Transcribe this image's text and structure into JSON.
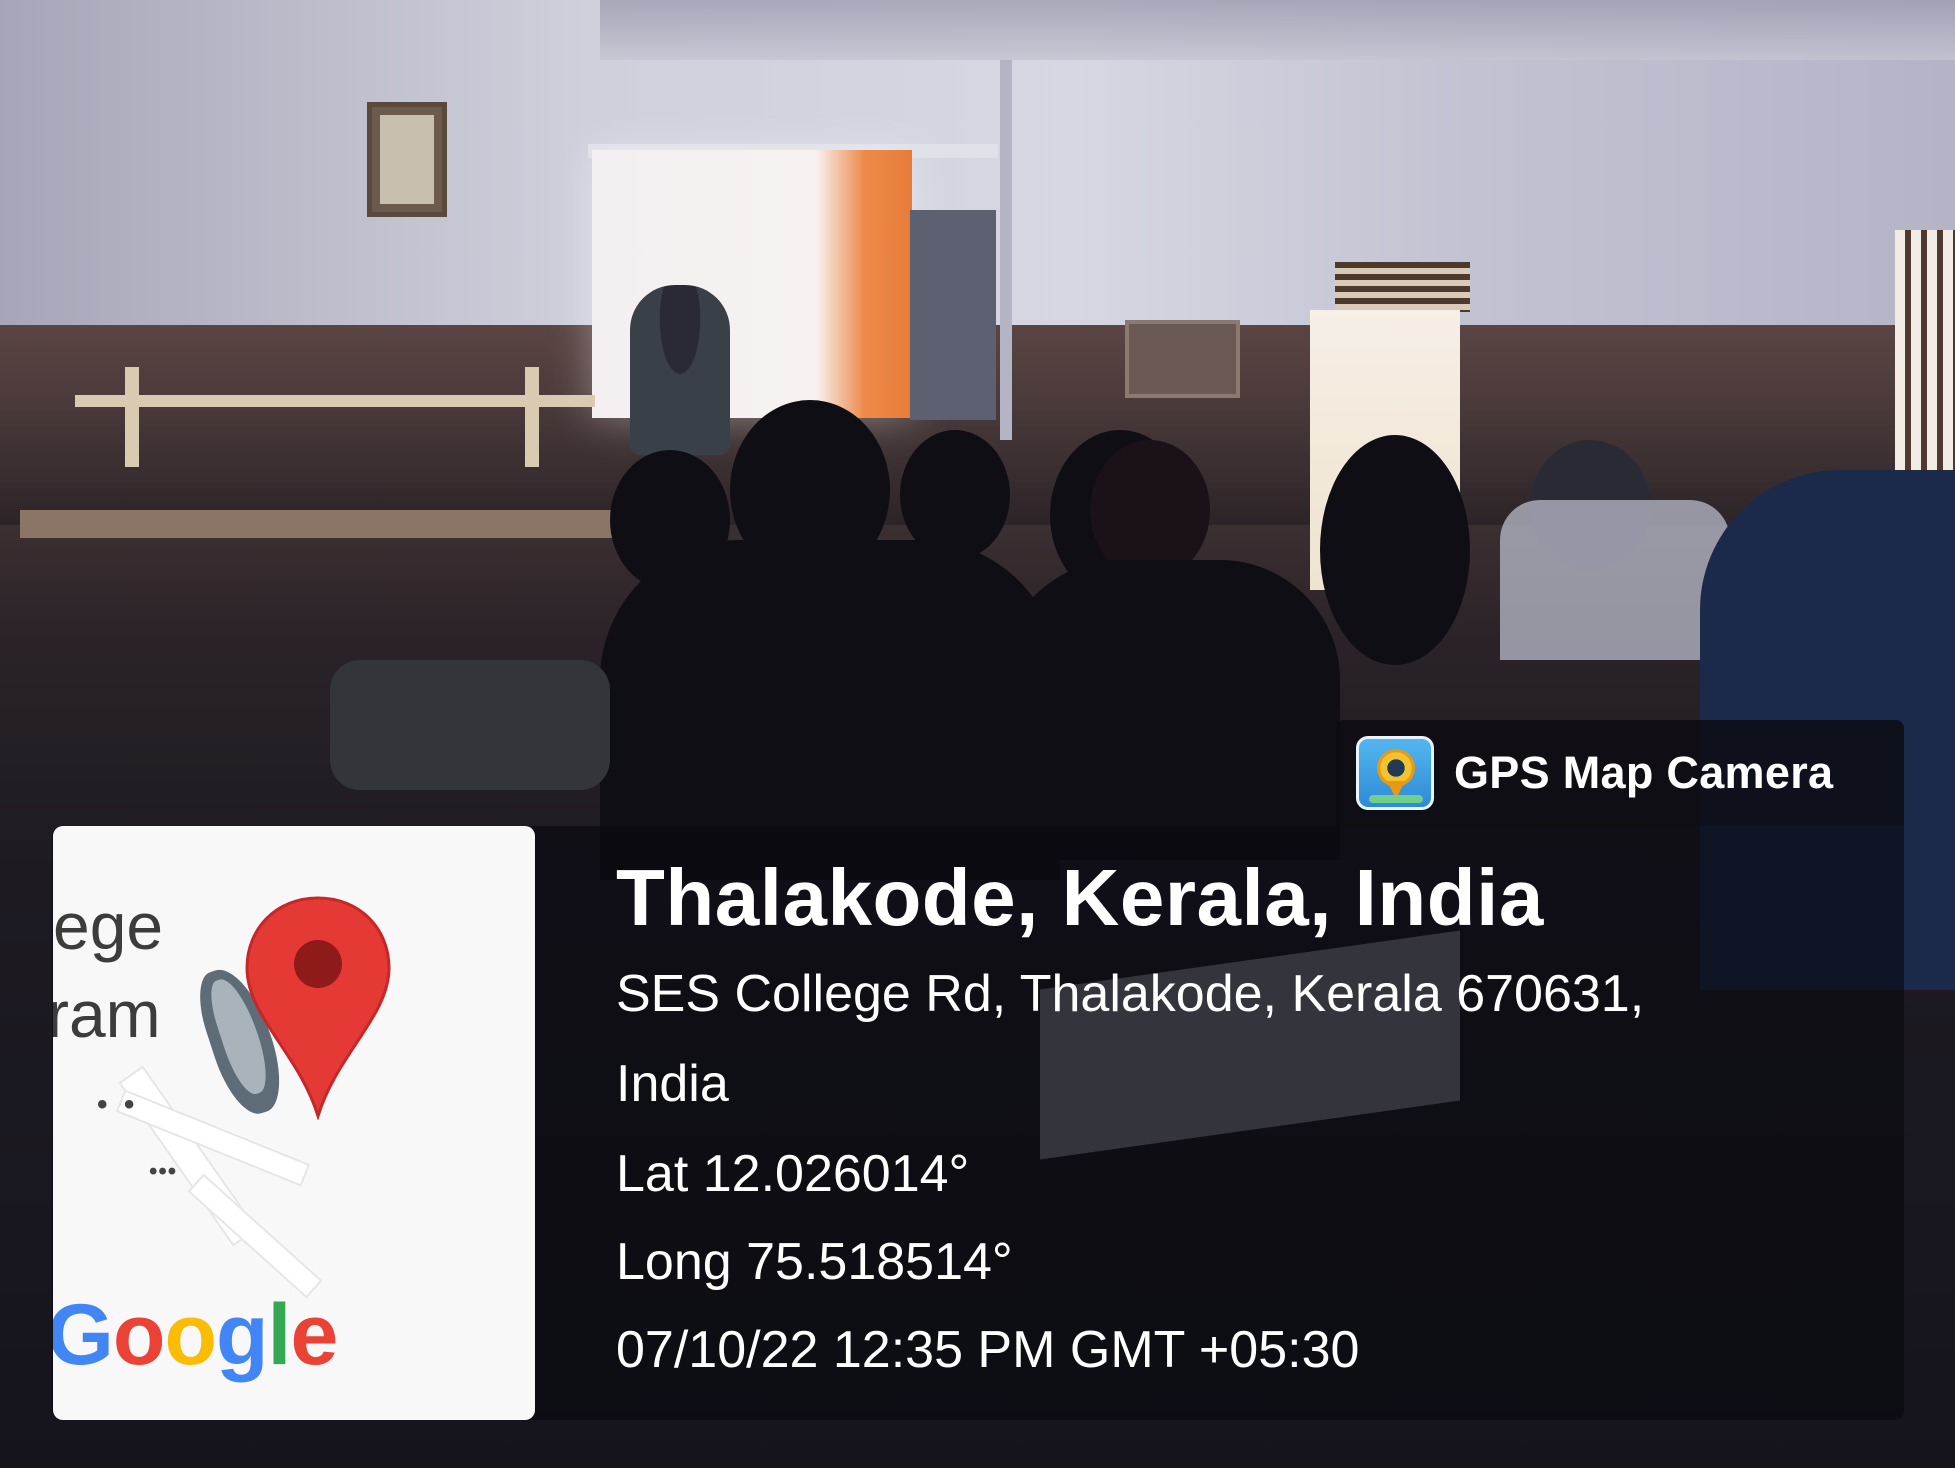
{
  "badge": {
    "title": "GPS Map Camera",
    "icon": "gps-map-camera-app-icon"
  },
  "map": {
    "labels": [
      "ege",
      "ram"
    ],
    "dots_1": "• •",
    "dots_2": "•••",
    "google_logo_letters": [
      "G",
      "o",
      "o",
      "g",
      "l",
      "e"
    ],
    "google_colors": [
      "#4285F4",
      "#EA4335",
      "#FBBC05",
      "#4285F4",
      "#34A853",
      "#EA4335"
    ],
    "pin_color": "#E53935"
  },
  "location": {
    "title": "Thalakode, Kerala, India",
    "address_line_1": "SES College Rd, Thalakode, Kerala 670631,",
    "address_line_2": "India",
    "lat": "Lat 12.026014°",
    "long": "Long 75.518514°",
    "datetime": "07/10/22 12:35 PM GMT +05:30"
  }
}
